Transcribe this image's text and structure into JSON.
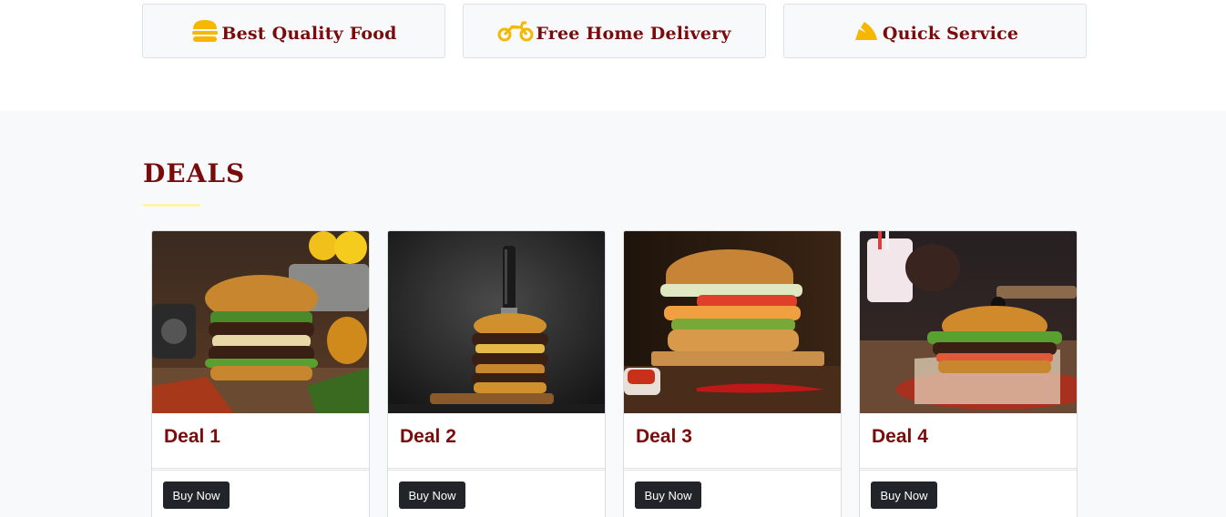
{
  "features": [
    {
      "label": "Best Quality Food",
      "icon": "burger-icon"
    },
    {
      "label": "Free Home Delivery",
      "icon": "motorcycle-icon"
    },
    {
      "label": "Quick Service",
      "icon": "speed-icon"
    }
  ],
  "deals": {
    "title": "DEALS",
    "cards": [
      {
        "title": "Deal 1",
        "button": "Buy Now"
      },
      {
        "title": "Deal 2",
        "button": "Buy Now"
      },
      {
        "title": "Deal 3",
        "button": "Buy Now"
      },
      {
        "title": "Deal 4",
        "button": "Buy Now"
      }
    ]
  },
  "colors": {
    "accent": "#7a0b0b",
    "icon": "#f5b700",
    "button": "#212529",
    "section_bg": "#f8f9fa"
  }
}
